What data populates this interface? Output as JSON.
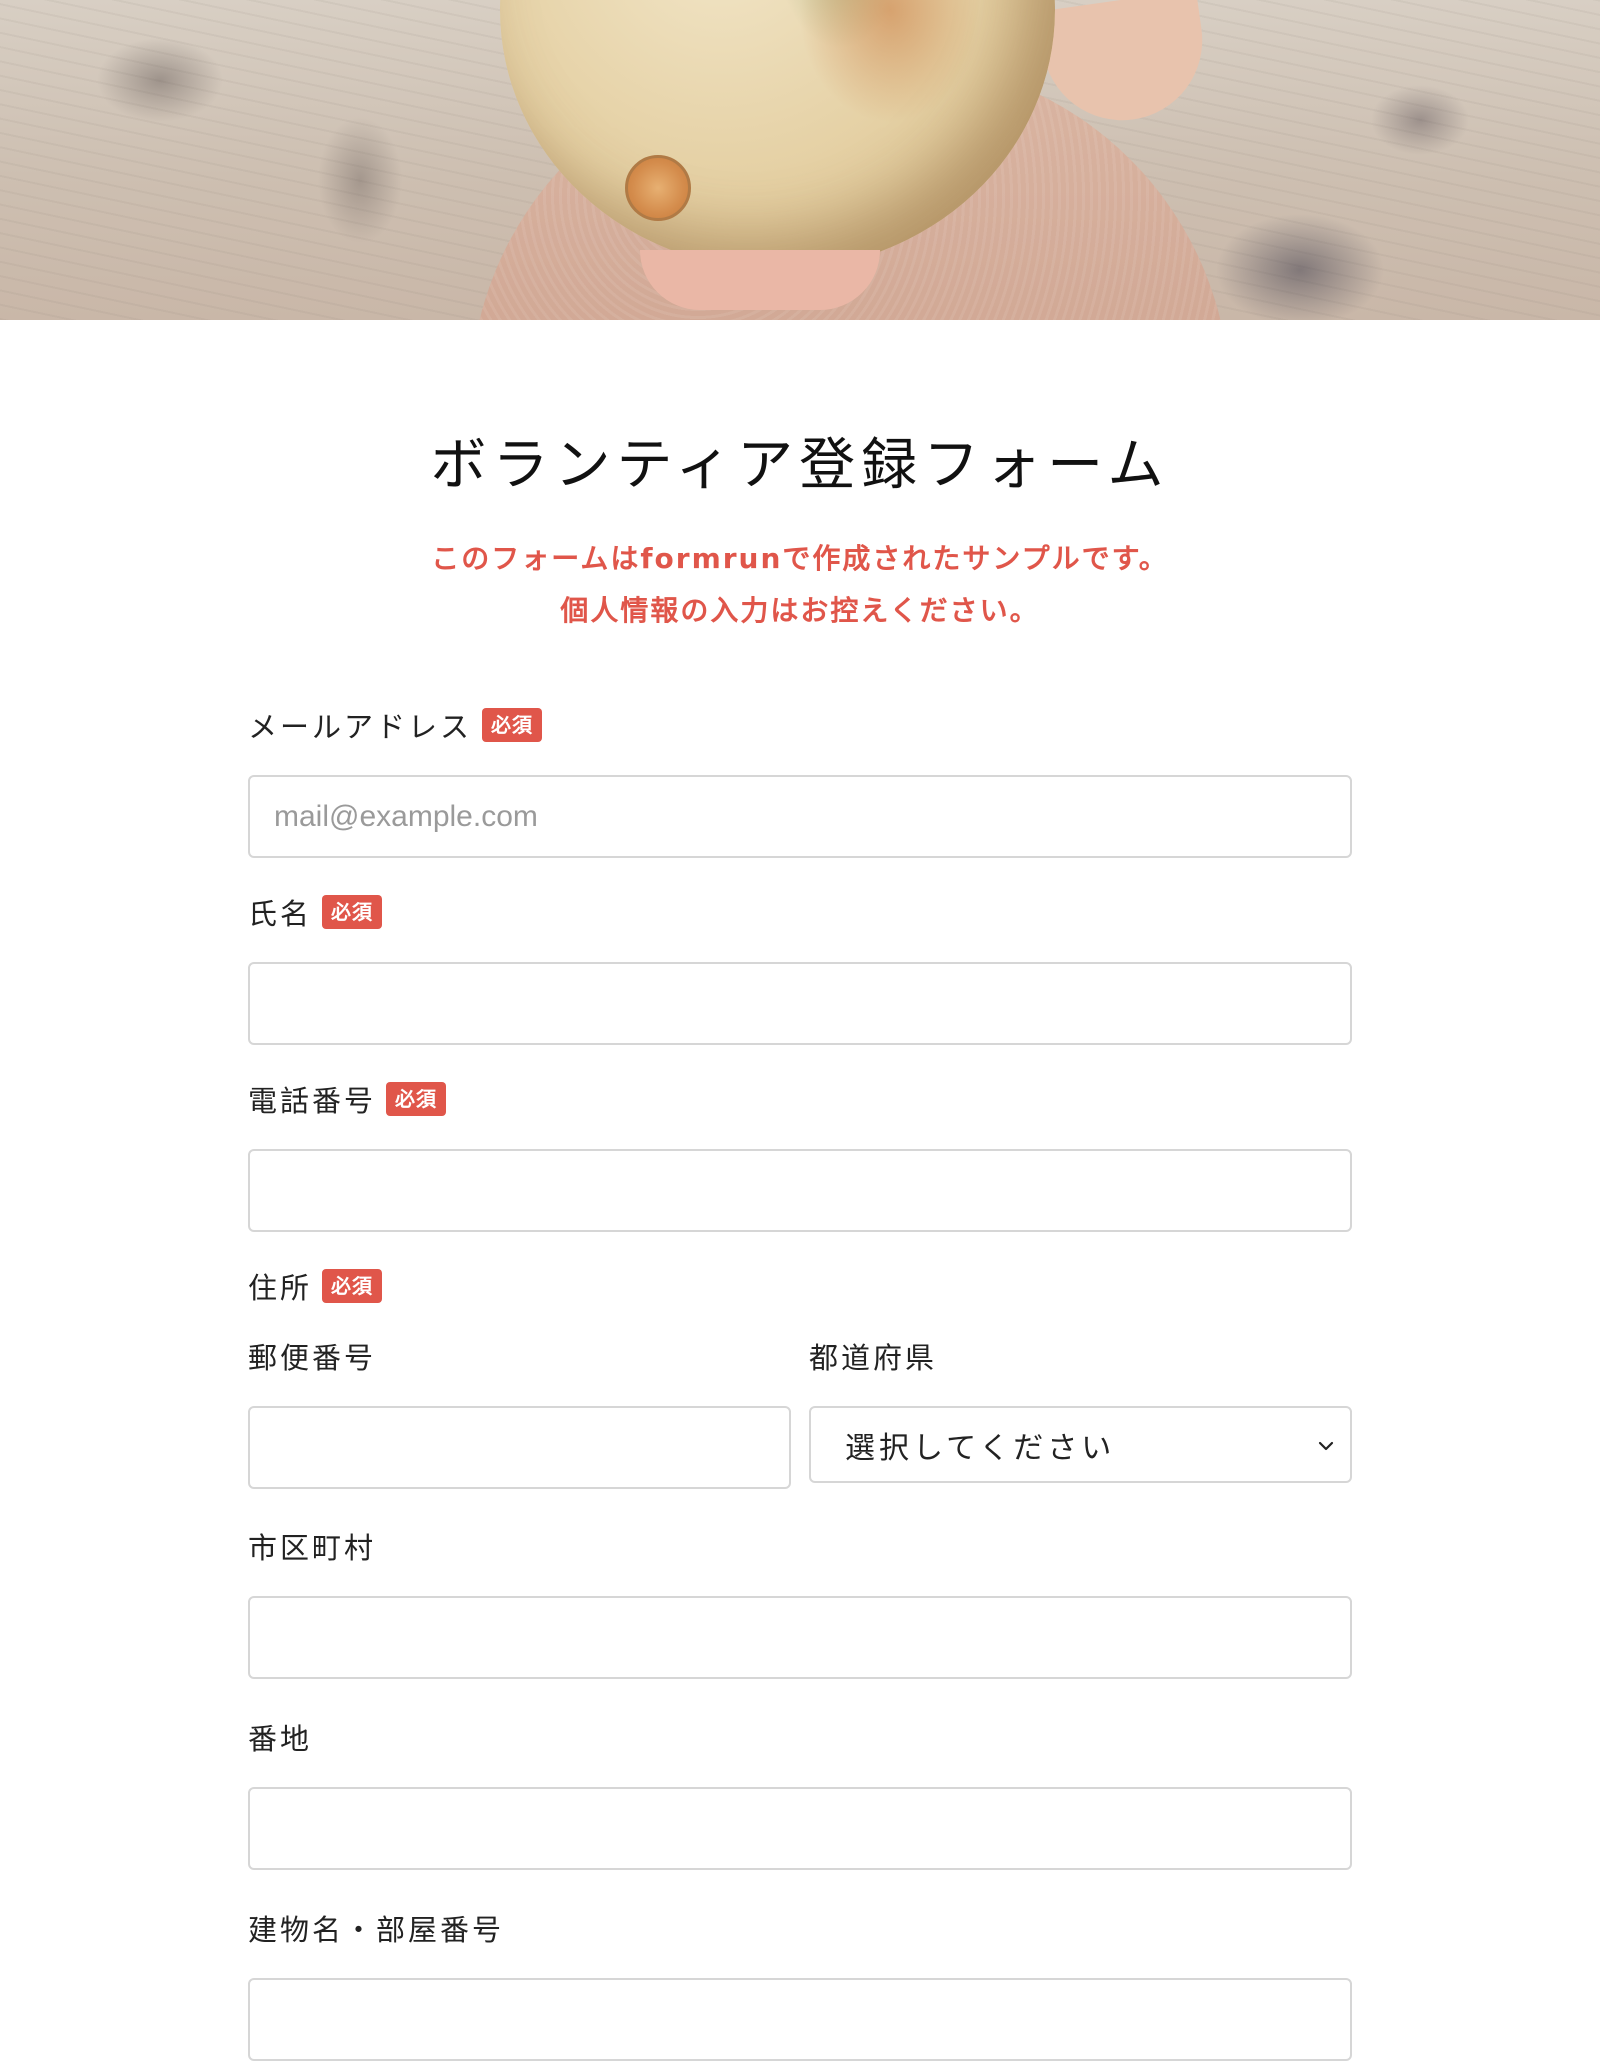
{
  "hero": {
    "image": "globe-held-by-person-photo"
  },
  "form": {
    "title": "ボランティア登録フォーム",
    "description_line1": "このフォームはformrunで作成されたサンプルです。",
    "description_line2": "個人情報の入力はお控えください。",
    "required_badge": "必須"
  },
  "fields": {
    "email": {
      "label": "メールアドレス",
      "placeholder": "mail@example.com",
      "value": ""
    },
    "name": {
      "label": "氏名",
      "value": ""
    },
    "phone": {
      "label": "電話番号",
      "value": ""
    },
    "address": {
      "label": "住所",
      "postal_code": {
        "label": "郵便番号",
        "value": ""
      },
      "prefecture": {
        "label": "都道府県",
        "selected": "選択してください"
      },
      "city": {
        "label": "市区町村",
        "value": ""
      },
      "street": {
        "label": "番地",
        "value": ""
      },
      "building": {
        "label": "建物名・部屋番号",
        "value": ""
      }
    }
  },
  "colors": {
    "accent": "#e0564a",
    "input_border": "#d6d6d6",
    "text": "#222222",
    "placeholder": "#9a9a9a"
  },
  "icons": {
    "select_chevron": "chevron-down-icon"
  }
}
